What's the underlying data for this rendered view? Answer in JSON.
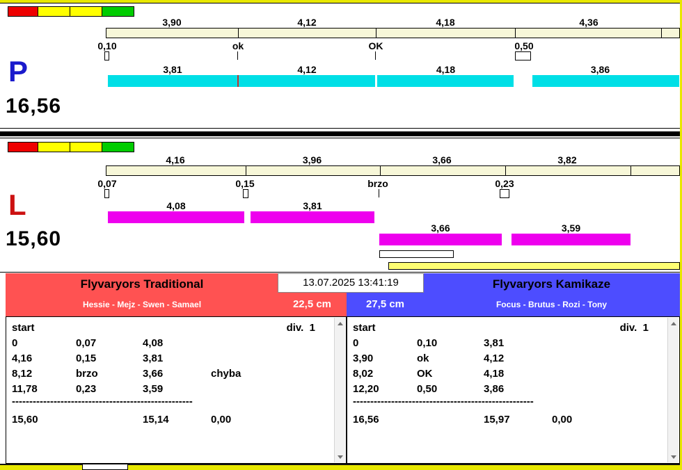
{
  "colors": {
    "window_frame": "#e8e800",
    "start_lights": [
      "#ee0000",
      "#ffff00",
      "#ffff00",
      "#00cc00"
    ],
    "schedule_bar": "#f7f7d8",
    "lane_p_bar": "#00dfe6",
    "lane_l_bar": "#ee00ee",
    "lane_p_letter": "#1a1acc",
    "lane_l_letter": "#cc1111",
    "header_left": "#ff5252",
    "header_right": "#4d4dff",
    "progress_yellow": "#ffff73"
  },
  "lane_p": {
    "label": "P",
    "total": "16,56",
    "splits": [
      "3,90",
      "4,12",
      "4,18",
      "4,36"
    ],
    "markers": [
      "0,10",
      "ok",
      "OK",
      "0,50"
    ],
    "runs": [
      "3,81",
      "4,12",
      "4,18",
      "3,86"
    ]
  },
  "lane_l": {
    "label": "L",
    "total": "15,60",
    "splits": [
      "4,16",
      "3,96",
      "3,66",
      "3,82"
    ],
    "markers": [
      "0,07",
      "0,15",
      "brzo",
      "0,23"
    ],
    "runs_row1": [
      "4,08",
      "3,81"
    ],
    "runs_row2": [
      "3,66",
      "3,59"
    ]
  },
  "scoreboard": {
    "timestamp": "13.07.2025 13:41:19",
    "left": {
      "team": "Flyvaryors Traditional",
      "dogs": "Hessie - Mejz - Swen - Samael",
      "jump_height": "22,5 cm",
      "start_label": "start",
      "division": "div.  1",
      "rows": [
        {
          "c1": "0",
          "c2": "0,07",
          "c3": "4,08",
          "c4": ""
        },
        {
          "c1": "4,16",
          "c2": "0,15",
          "c3": "3,81",
          "c4": ""
        },
        {
          "c1": "8,12",
          "c2": "brzo",
          "c3": "3,66",
          "c4": "chyba"
        },
        {
          "c1": "11,78",
          "c2": "0,23",
          "c3": "3,59",
          "c4": ""
        }
      ],
      "separator": "----------------------------------------------------",
      "total": {
        "time": "15,60",
        "sum": "15,14",
        "penalty": "0,00"
      }
    },
    "right": {
      "team": "Flyvaryors Kamikaze",
      "dogs": "Focus - Brutus - Rozi - Tony",
      "jump_height": "27,5 cm",
      "start_label": "start",
      "division": "div.  1",
      "rows": [
        {
          "c1": "0",
          "c2": "0,10",
          "c3": "3,81",
          "c4": ""
        },
        {
          "c1": "3,90",
          "c2": "ok",
          "c3": "4,12",
          "c4": ""
        },
        {
          "c1": "8,02",
          "c2": "OK",
          "c3": "4,18",
          "c4": ""
        },
        {
          "c1": "12,20",
          "c2": "0,50",
          "c3": "3,86",
          "c4": ""
        }
      ],
      "separator": "----------------------------------------------------",
      "total": {
        "time": "16,56",
        "sum": "15,97",
        "penalty": "0,00"
      }
    }
  }
}
